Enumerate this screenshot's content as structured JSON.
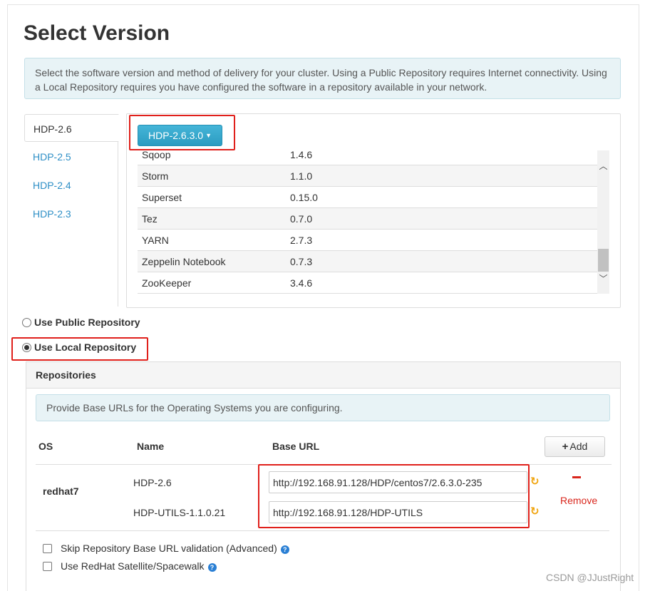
{
  "page": {
    "title": "Select Version"
  },
  "intro_alert": "Select the software version and method of delivery for your cluster. Using a Public Repository requires Internet connectivity. Using a Local Repository requires you have configured the software in a repository available in your network.",
  "version_tabs": [
    {
      "label": "HDP-2.6",
      "active": true
    },
    {
      "label": "HDP-2.5",
      "active": false
    },
    {
      "label": "HDP-2.4",
      "active": false
    },
    {
      "label": "HDP-2.3",
      "active": false
    }
  ],
  "version_dropdown": {
    "label": "HDP-2.6.3.0"
  },
  "stack_services": [
    {
      "service": "Sqoop",
      "version": "1.4.6"
    },
    {
      "service": "Storm",
      "version": "1.1.0"
    },
    {
      "service": "Superset",
      "version": "0.15.0"
    },
    {
      "service": "Tez",
      "version": "0.7.0"
    },
    {
      "service": "YARN",
      "version": "2.7.3"
    },
    {
      "service": "Zeppelin Notebook",
      "version": "0.7.3"
    },
    {
      "service": "ZooKeeper",
      "version": "3.4.6"
    }
  ],
  "repo_options": {
    "public": {
      "label": "Use Public Repository",
      "checked": false
    },
    "local": {
      "label": "Use Local Repository",
      "checked": true
    }
  },
  "repositories": {
    "header": "Repositories",
    "alert": "Provide Base URLs for the Operating Systems you are configuring.",
    "columns": {
      "os": "OS",
      "name": "Name",
      "base_url": "Base URL"
    },
    "add_label": "Add",
    "os": "redhat7",
    "remove_label": "Remove",
    "entries": [
      {
        "name": "HDP-2.6",
        "base_url": "http://192.168.91.128/HDP/centos7/2.6.3.0-235"
      },
      {
        "name": "HDP-UTILS-1.1.0.21",
        "base_url": "http://192.168.91.128/HDP-UTILS"
      }
    ],
    "options": [
      {
        "label": "Skip Repository Base URL validation (Advanced)",
        "checked": false
      },
      {
        "label": "Use RedHat Satellite/Spacewalk",
        "checked": false
      }
    ]
  },
  "watermark": "CSDN @JJustRight",
  "colors": {
    "primary_button": "#2b9cc1",
    "highlight_box": "#e0201b",
    "remove": "#d9261c",
    "link": "#2e8fc6"
  }
}
